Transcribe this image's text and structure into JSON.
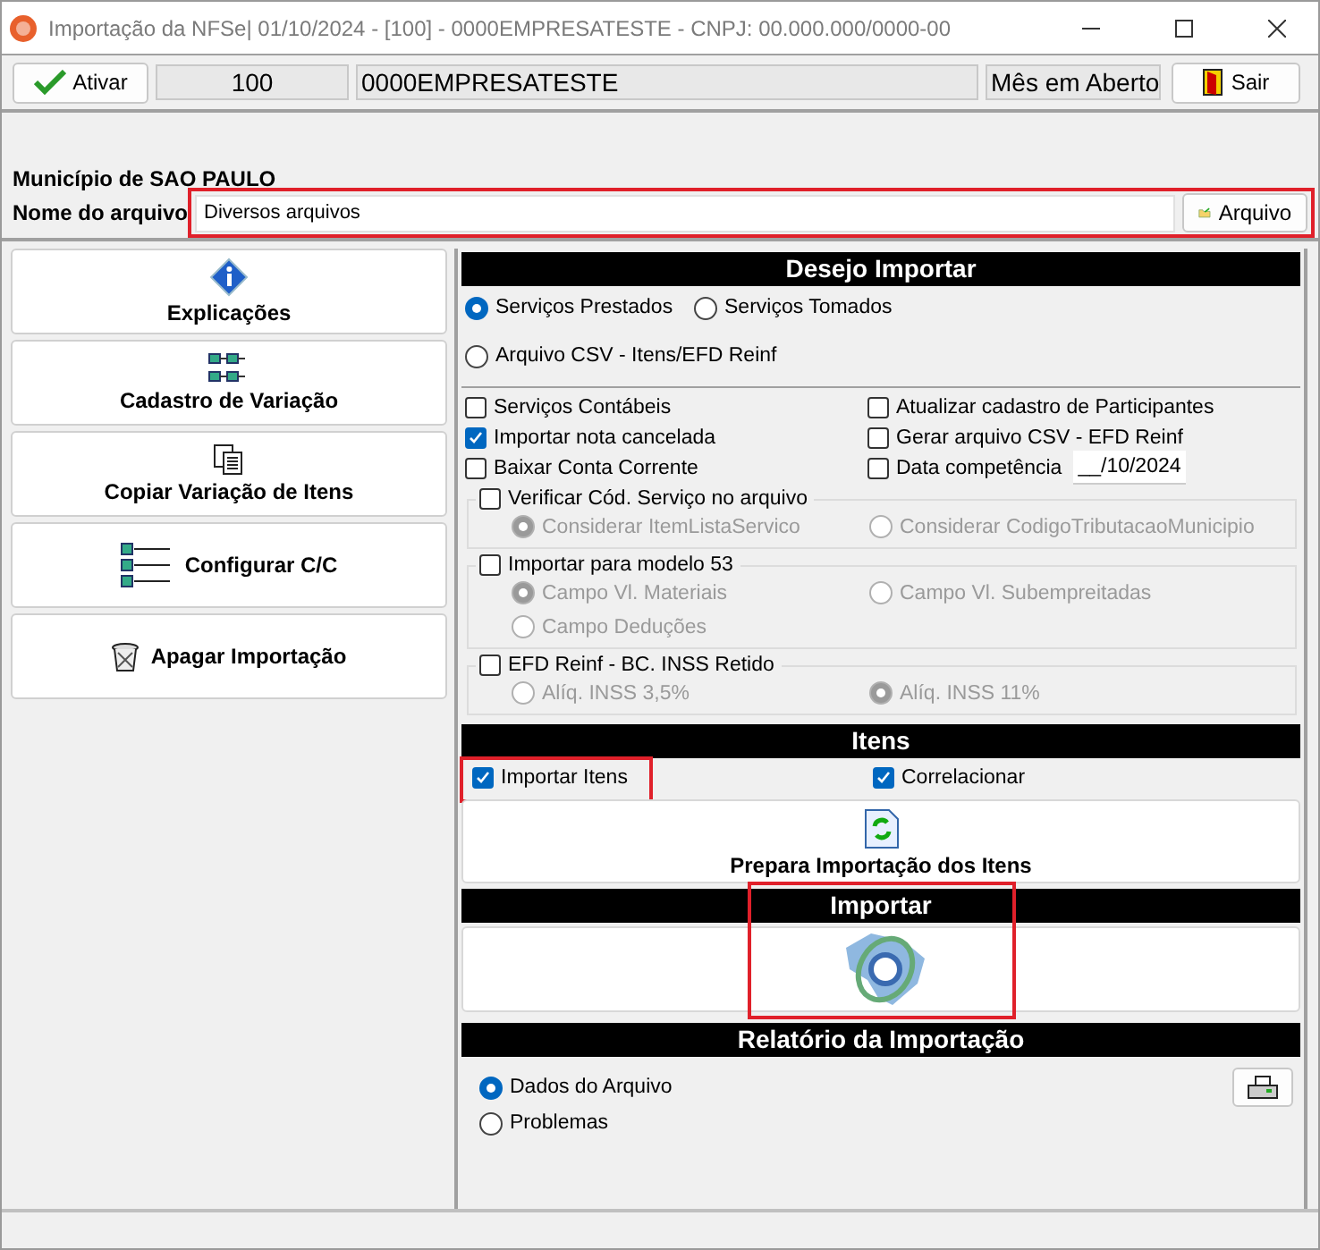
{
  "window": {
    "title": "Importação da NFSe|  01/10/2024 - [100] - 0000EMPRESATESTE - CNPJ: 00.000.000/0000-00"
  },
  "toolbar": {
    "activate_button": "Ativar",
    "code": "100",
    "company": "0000EMPRESATESTE",
    "period": "Mês em Aberto",
    "exit_button": "Sair"
  },
  "file_section": {
    "municipality": "Município de SAO PAULO",
    "file_label": "Nome do arquivo",
    "file_value": "Diversos arquivos",
    "file_button": "Arquivo",
    "highlighted": true
  },
  "side_buttons": [
    {
      "label": "Explicações"
    },
    {
      "label": "Cadastro de Variação"
    },
    {
      "label": "Copiar Variação de Itens"
    },
    {
      "label": "Configurar C/C"
    },
    {
      "label": "Apagar Importação"
    }
  ],
  "import_options": {
    "title": "Desejo Importar",
    "source_radios": [
      {
        "label": "Serviços Prestados",
        "selected": true
      },
      {
        "label": "Serviços Tomados",
        "selected": false
      },
      {
        "label": "Arquivo CSV - Itens/EFD Reinf",
        "selected": false
      }
    ],
    "checkboxes": [
      {
        "label": "Serviços Contábeis",
        "checked": false
      },
      {
        "label": "Atualizar cadastro de Participantes",
        "checked": false
      },
      {
        "label": "Importar nota cancelada",
        "checked": true
      },
      {
        "label": "Gerar arquivo CSV - EFD Reinf",
        "checked": false
      },
      {
        "label": "Baixar Conta Corrente",
        "checked": false
      },
      {
        "label": "Data competência",
        "checked": false
      }
    ],
    "date_value": "__/10/2024",
    "groups": [
      {
        "label": "Verificar Cód. Serviço no arquivo",
        "checked": false,
        "radios": [
          {
            "label": "Considerar ItemListaServico",
            "selected": true,
            "disabled": true
          },
          {
            "label": "Considerar CodigoTributacaoMunicipio",
            "selected": false,
            "disabled": true
          }
        ]
      },
      {
        "label": "Importar para modelo 53",
        "checked": false,
        "radios": [
          {
            "label": "Campo Vl. Materiais",
            "selected": true,
            "disabled": true
          },
          {
            "label": "Campo Vl. Subempreitadas",
            "selected": false,
            "disabled": true
          },
          {
            "label": "Campo Deduções",
            "selected": false,
            "disabled": true
          }
        ]
      },
      {
        "label": "EFD Reinf - BC. INSS Retido",
        "checked": false,
        "radios": [
          {
            "label": "Alíq. INSS 3,5%",
            "selected": false,
            "disabled": true
          },
          {
            "label": "Alíq. INSS 11%",
            "selected": true,
            "disabled": true
          }
        ]
      }
    ]
  },
  "items": {
    "title": "Itens",
    "checkboxes": [
      {
        "label": "Importar Itens",
        "checked": true,
        "highlighted": true
      },
      {
        "label": "Correlacionar",
        "checked": true,
        "highlighted": false
      }
    ],
    "prepare_button": "Prepara Importação dos Itens"
  },
  "import": {
    "title": "Importar",
    "highlighted": true
  },
  "report": {
    "title": "Relatório da Importação",
    "radios": [
      {
        "label": "Dados do Arquivo",
        "selected": true
      },
      {
        "label": "Problemas",
        "selected": false
      }
    ]
  }
}
